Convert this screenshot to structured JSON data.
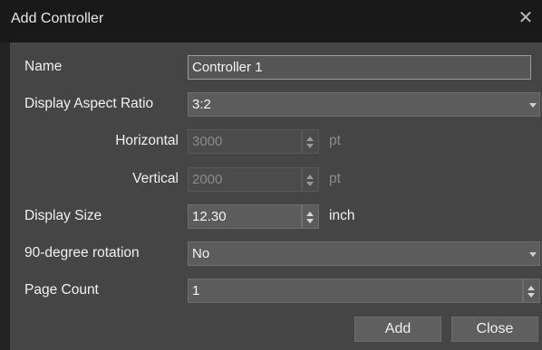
{
  "window": {
    "title": "Add Controller"
  },
  "form": {
    "name": {
      "label": "Name",
      "value": "Controller 1"
    },
    "aspect_ratio": {
      "label": "Display Aspect Ratio",
      "value": "3:2"
    },
    "horizontal": {
      "label": "Horizontal",
      "value": "3000",
      "unit": "pt"
    },
    "vertical": {
      "label": "Vertical",
      "value": "2000",
      "unit": "pt"
    },
    "display_size": {
      "label": "Display Size",
      "value": "12.30",
      "unit": "inch"
    },
    "rotation": {
      "label": "90-degree rotation",
      "value": "No"
    },
    "page_count": {
      "label": "Page Count",
      "value": "1"
    }
  },
  "buttons": {
    "add": "Add",
    "close": "Close"
  },
  "icons": {
    "close": "close-icon",
    "dropdown": "chevron-down-icon",
    "spinner": "spinner-arrows-icon"
  }
}
